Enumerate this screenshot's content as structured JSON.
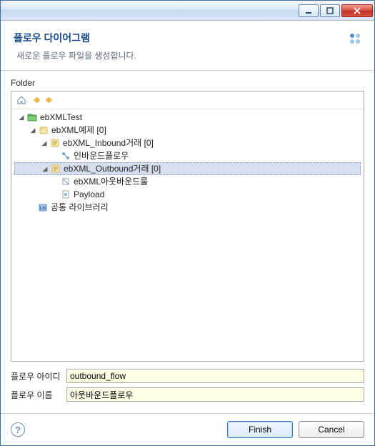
{
  "header": {
    "title": "플로우 다이어그램",
    "description": "새로운 플로우 파일을 생성합니다."
  },
  "folder_label": "Folder",
  "tree": {
    "root": "ebXMLTest",
    "items": [
      {
        "label": "ebXML예제 [0]"
      },
      {
        "label": "ebXML_Inbound거래 [0]"
      },
      {
        "label": "인바운드플로우"
      },
      {
        "label": "ebXML_Outbound거래 [0]",
        "selected": true
      },
      {
        "label": "ebXML아웃바운드룰"
      },
      {
        "label": "Payload"
      },
      {
        "label": "공통 라이브러리"
      }
    ]
  },
  "form": {
    "flow_id_label": "플로우 아이디",
    "flow_id_value": "outbound_flow",
    "flow_name_label": "플로우 이름",
    "flow_name_value": "아웃바운드플로우"
  },
  "buttons": {
    "finish": "Finish",
    "cancel": "Cancel"
  }
}
